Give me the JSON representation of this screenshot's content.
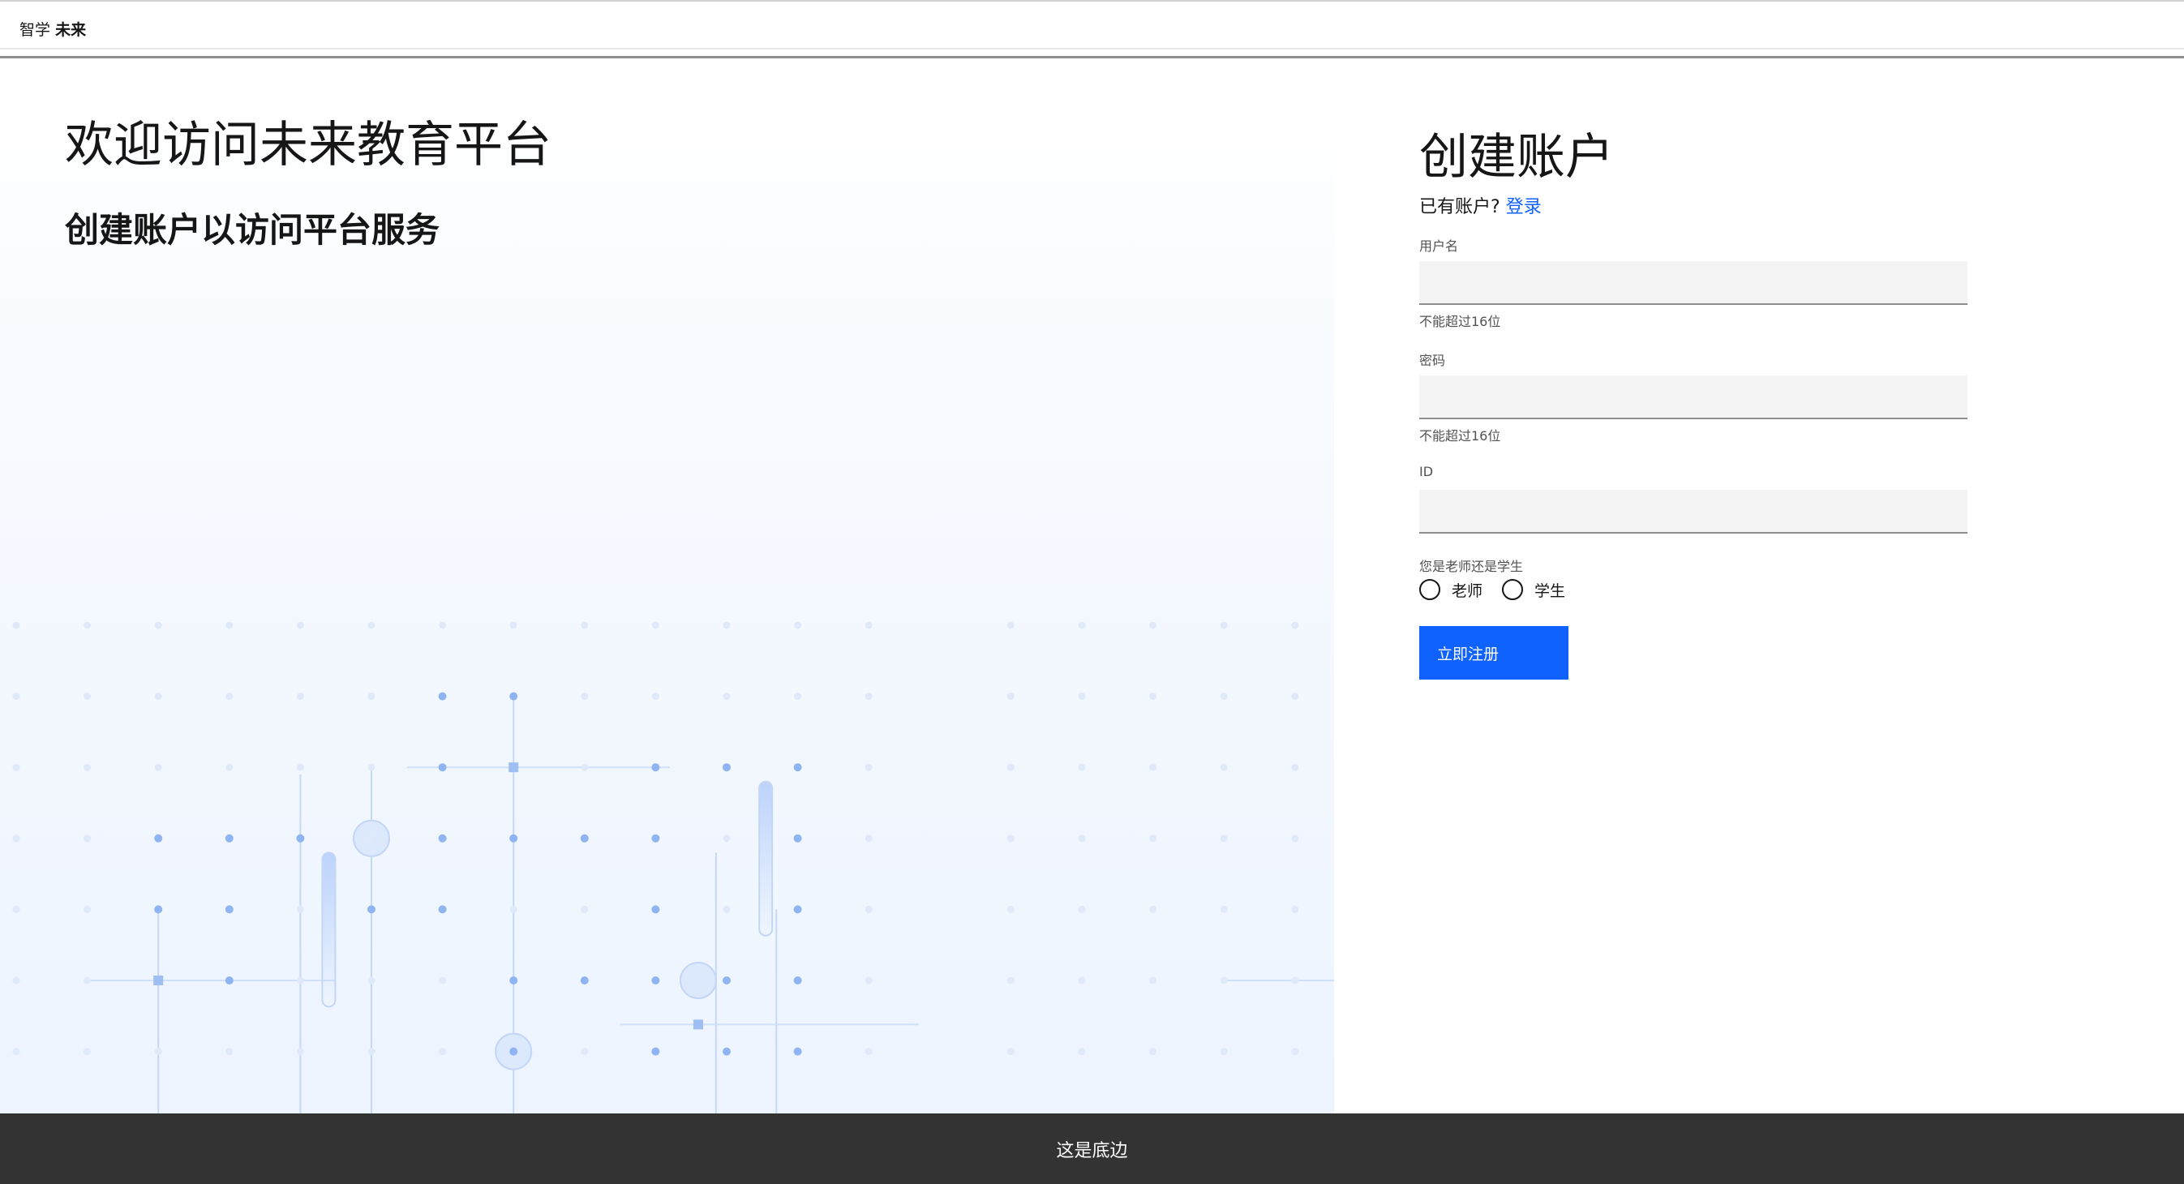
{
  "header": {
    "brand_prefix": "智学",
    "brand_name": "未来"
  },
  "hero": {
    "title": "欢迎访问未来教育平台",
    "subtitle": "创建账户以访问平台服务"
  },
  "form": {
    "title": "创建账户",
    "login_prompt": "已有账户?",
    "login_link": "登录",
    "username_label": "用户名",
    "username_value": "",
    "username_helper": "不能超过16位",
    "password_label": "密码",
    "password_value": "",
    "password_helper": "不能超过16位",
    "id_label": "ID",
    "id_value": "",
    "role_label": "您是老师还是学生",
    "role_options": [
      "老师",
      "学生"
    ],
    "submit_label": "立即注册"
  },
  "footer": {
    "text": "这是底边"
  },
  "colors": {
    "accent": "#0f62fe",
    "footer_bg": "#333333",
    "input_bg": "#f4f4f4"
  }
}
